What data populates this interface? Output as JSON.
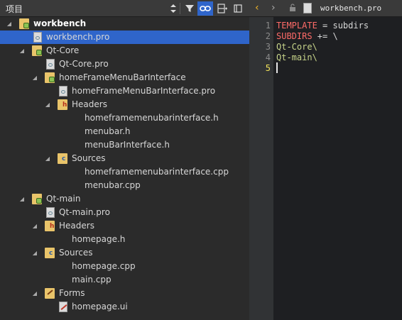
{
  "toolbar": {
    "project_label": "项目",
    "icons": [
      "updown-icon",
      "filter-icon",
      "link-icon",
      "split-icon",
      "close-panel-icon"
    ]
  },
  "tree": [
    {
      "label": "workbench",
      "icon": "qt-project-folder-icon",
      "expanded": true,
      "bold": true
    },
    {
      "label": "workbench.pro",
      "icon": "pro-file-icon",
      "selected": true
    },
    {
      "label": "Qt-Core",
      "icon": "qt-project-folder-icon",
      "expanded": true
    },
    {
      "label": "Qt-Core.pro",
      "icon": "pro-file-icon"
    },
    {
      "label": "homeFrameMenuBarInterface",
      "icon": "qt-project-folder-icon",
      "expanded": true
    },
    {
      "label": "homeFrameMenuBarInterface.pro",
      "icon": "pro-file-icon"
    },
    {
      "label": "Headers",
      "icon": "headers-folder-icon",
      "expanded": true
    },
    {
      "label": "homeframemenubarinterface.h",
      "icon": ""
    },
    {
      "label": "menubar.h",
      "icon": ""
    },
    {
      "label": "menuBarInterface.h",
      "icon": ""
    },
    {
      "label": "Sources",
      "icon": "sources-folder-icon",
      "expanded": true
    },
    {
      "label": "homeframemenubarinterface.cpp",
      "icon": ""
    },
    {
      "label": "menubar.cpp",
      "icon": ""
    },
    {
      "label": "Qt-main",
      "icon": "qt-project-folder-icon",
      "expanded": true
    },
    {
      "label": "Qt-main.pro",
      "icon": "pro-file-icon"
    },
    {
      "label": "Headers",
      "icon": "headers-folder-icon",
      "expanded": true
    },
    {
      "label": "homepage.h",
      "icon": ""
    },
    {
      "label": "Sources",
      "icon": "sources-folder-icon",
      "expanded": true
    },
    {
      "label": "homepage.cpp",
      "icon": ""
    },
    {
      "label": "main.cpp",
      "icon": ""
    },
    {
      "label": "Forms",
      "icon": "forms-folder-icon",
      "expanded": true
    },
    {
      "label": "homepage.ui",
      "icon": "ui-file-icon"
    }
  ],
  "editor": {
    "file_name": "workbench.pro",
    "line_numbers": [
      "1",
      "2",
      "3",
      "4",
      "5"
    ],
    "current_line": "5",
    "lines": [
      {
        "key": "TEMPLATE",
        "op": " = ",
        "value": "subdirs"
      },
      {
        "key": "SUBDIRS",
        "op": " += ",
        "value": "\\"
      },
      {
        "key": "",
        "op": "",
        "value": "Qt-Core\\"
      },
      {
        "key": "",
        "op": "",
        "value": "Qt-main\\"
      },
      {
        "key": "",
        "op": "",
        "value": ""
      }
    ]
  },
  "colors": {
    "selection": "#2f65ca",
    "keyword": "#ff6b68",
    "path": "#c7d48a",
    "current_line_number": "#f2e35a"
  }
}
